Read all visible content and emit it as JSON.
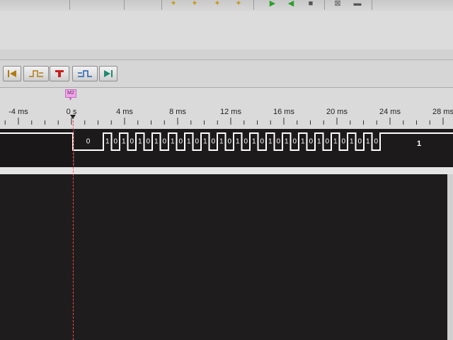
{
  "timeline": {
    "marker_label": "M2",
    "ticks": [
      "-4 ms",
      "0 s",
      "4 ms",
      "8 ms",
      "12 ms",
      "16 ms",
      "20 ms",
      "24 ms",
      "28 ms"
    ]
  },
  "signal": {
    "initial_value": "0",
    "final_value": "1",
    "bits": [
      "1",
      "0",
      "1",
      "0",
      "1",
      "0",
      "1",
      "0",
      "1",
      "0",
      "1",
      "0",
      "1",
      "0",
      "1",
      "0",
      "1",
      "0",
      "1",
      "0",
      "1",
      "0",
      "1",
      "0",
      "1",
      "0",
      "1",
      "0",
      "1",
      "0",
      "1",
      "0",
      "1",
      "0"
    ]
  },
  "toolbar": {
    "buttons": [
      "jump-start",
      "previous-edge",
      "trigger",
      "next-edge",
      "jump-end"
    ]
  },
  "colors": {
    "wave_bg": "#1c1a1a",
    "wave_line": "#ffffff",
    "cursor": "#ff4a4a",
    "marker_tag": "#f0a6e8"
  }
}
